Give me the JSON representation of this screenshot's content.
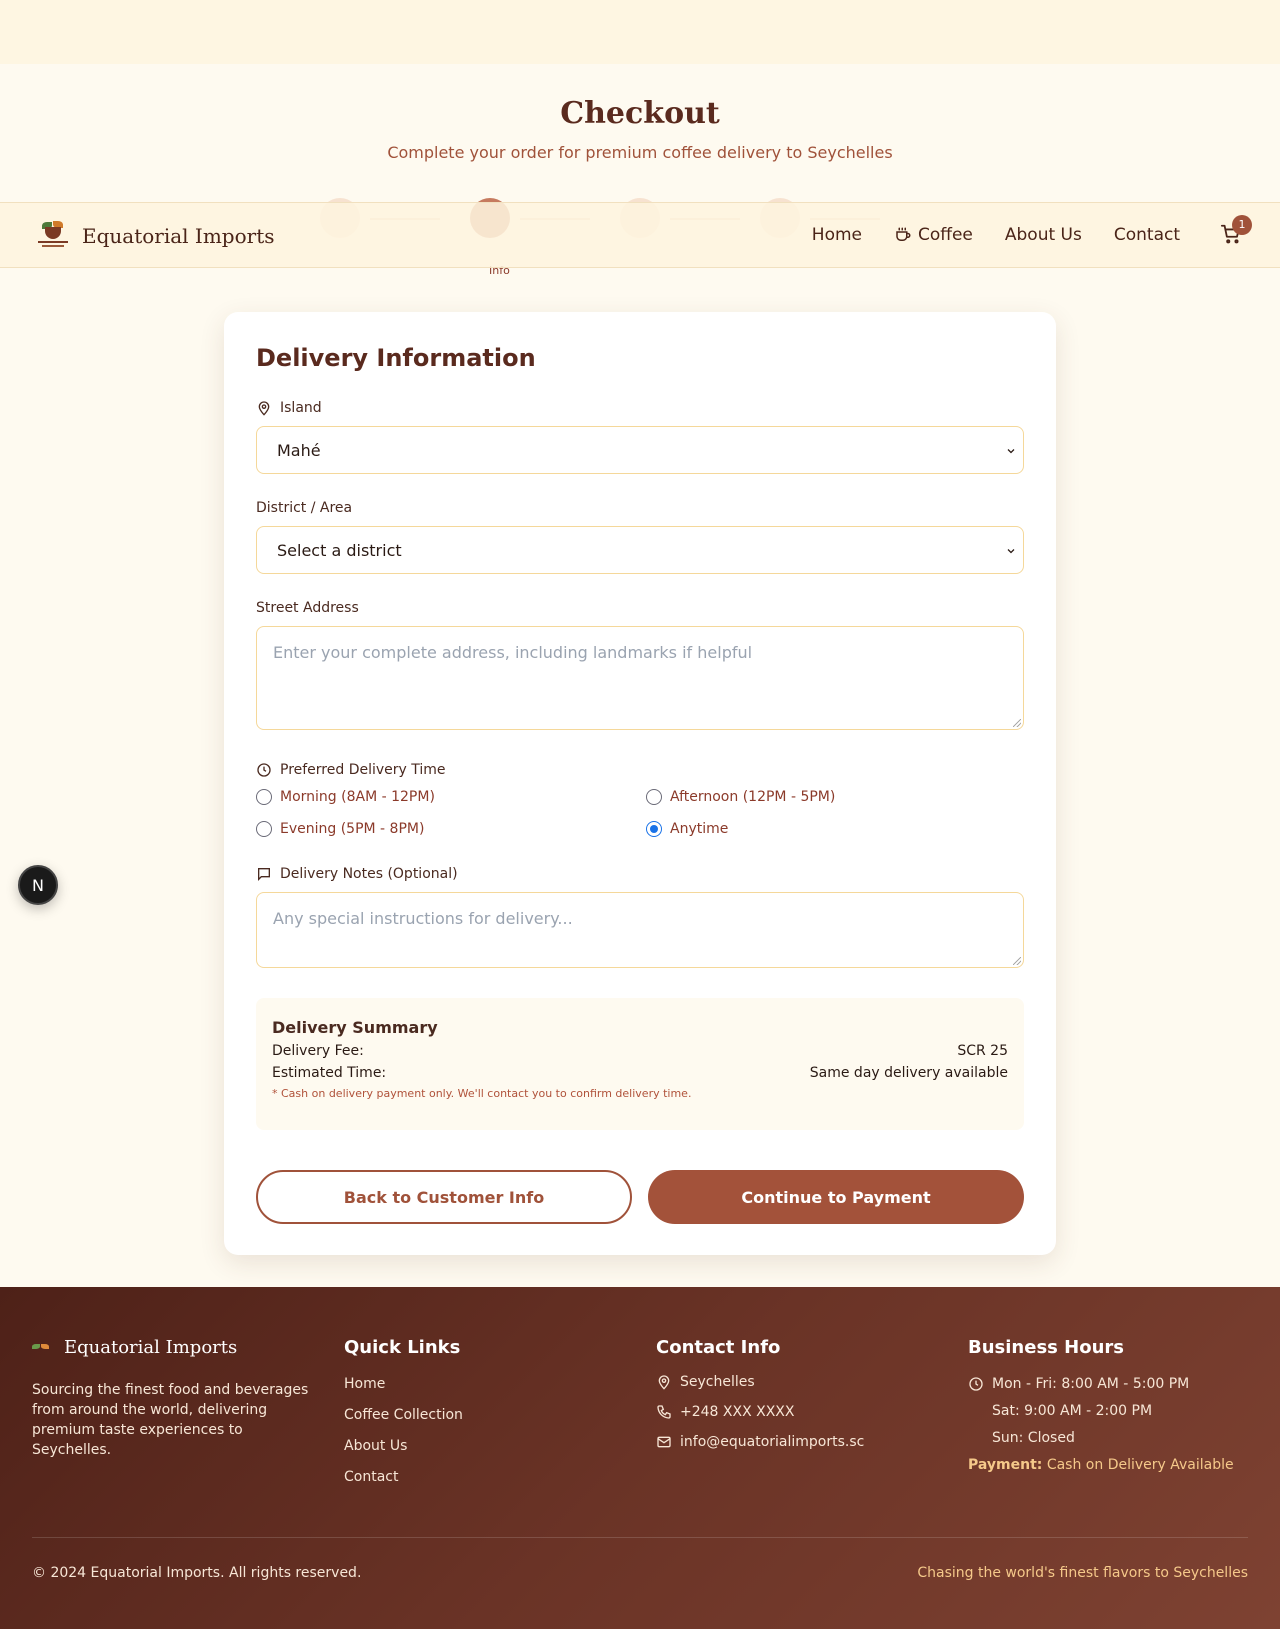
{
  "page": {
    "title": "Checkout",
    "subtitle": "Complete your order for premium coffee delivery to Seychelles"
  },
  "progress": {
    "visible_label": "Info"
  },
  "navbar": {
    "brand": "Equatorial Imports",
    "links": [
      "Home",
      "Coffee",
      "About Us",
      "Contact"
    ],
    "cart_count": "1"
  },
  "form": {
    "title": "Delivery Information",
    "island": {
      "label": "Island",
      "value": "Mahé"
    },
    "district": {
      "label": "District / Area",
      "value": "Select a district"
    },
    "street": {
      "label": "Street Address",
      "placeholder": "Enter your complete address, including landmarks if helpful"
    },
    "time": {
      "label": "Preferred Delivery Time",
      "options": [
        "Morning (8AM - 12PM)",
        "Afternoon (12PM - 5PM)",
        "Evening (5PM - 8PM)",
        "Anytime"
      ],
      "selected": "Anytime"
    },
    "notes": {
      "label": "Delivery Notes (Optional)",
      "placeholder": "Any special instructions for delivery..."
    },
    "summary": {
      "title": "Delivery Summary",
      "fee_label": "Delivery Fee:",
      "fee_value": "SCR 25",
      "time_label": "Estimated Time:",
      "time_value": "Same day delivery available",
      "note": "* Cash on delivery payment only. We'll contact you to confirm delivery time."
    },
    "back_button": "Back to Customer Info",
    "continue_button": "Continue to Payment"
  },
  "floating_badge": "N",
  "footer": {
    "brand": "Equatorial Imports",
    "description": "Sourcing the finest food and beverages from around the world, delivering premium taste experiences to Seychelles.",
    "quick_links": {
      "title": "Quick Links",
      "items": [
        "Home",
        "Coffee Collection",
        "About Us",
        "Contact"
      ]
    },
    "contact": {
      "title": "Contact Info",
      "location": "Seychelles",
      "phone": "+248 XXX XXXX",
      "email": "info@equatorialimports.sc"
    },
    "hours": {
      "title": "Business Hours",
      "weekdays": "Mon - Fri: 8:00 AM - 5:00 PM",
      "saturday": "Sat: 9:00 AM - 2:00 PM",
      "sunday": "Sun: Closed",
      "payment_label": "Payment:",
      "payment_value": "Cash on Delivery Available"
    },
    "copyright": "© 2024 Equatorial Imports. All rights reserved.",
    "tagline": "Chasing the world's finest flavors to Seychelles"
  },
  "colors": {
    "accent": "#a3523a",
    "heading": "#5a2a1e",
    "input_border": "#f5d89a",
    "radio_selected": "#1a73e8"
  }
}
